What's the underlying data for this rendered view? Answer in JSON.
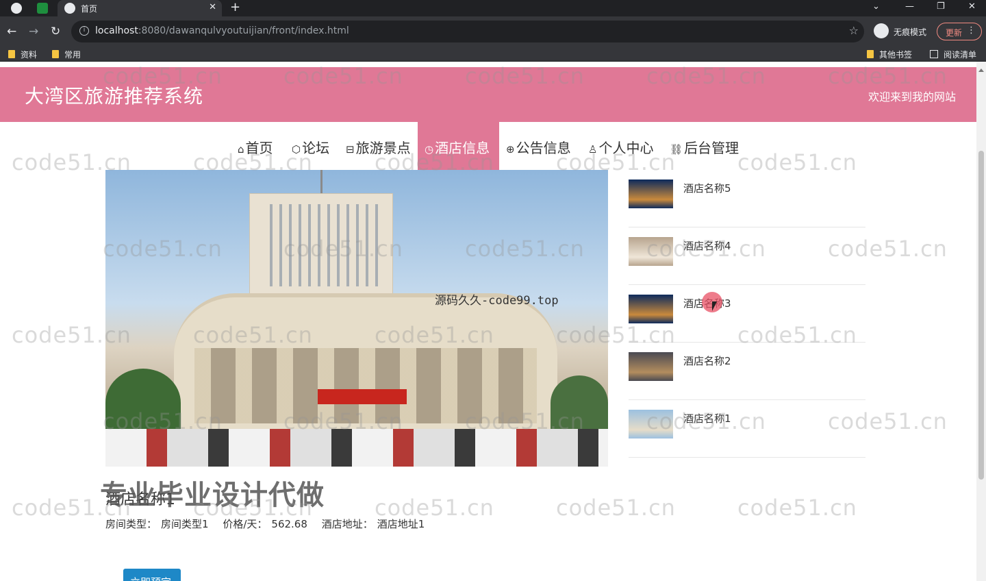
{
  "browser": {
    "tab_title": "首页",
    "url_host": "localhost",
    "url_path": ":8080/dawanqulvyoutuijian/front/index.html",
    "incognito_label": "无痕模式",
    "update_label": "更新",
    "bookmarks": [
      "资料",
      "常用"
    ],
    "bookmarks_right": [
      "其他书签",
      "阅读清单"
    ]
  },
  "site": {
    "title": "大湾区旅游推荐系统",
    "welcome": "欢迎来到我的网站",
    "accent_color": "#e07896"
  },
  "nav": [
    {
      "label": "首页",
      "icon": "home-icon",
      "glyph": "⌂"
    },
    {
      "label": "论坛",
      "icon": "cube-icon",
      "glyph": "⬡"
    },
    {
      "label": "旅游景点",
      "icon": "gift-icon",
      "glyph": "⊟"
    },
    {
      "label": "酒店信息",
      "icon": "clock-icon",
      "glyph": "◷",
      "active": true
    },
    {
      "label": "公告信息",
      "icon": "globe-icon",
      "glyph": "⊕"
    },
    {
      "label": "个人中心",
      "icon": "user-icon",
      "glyph": "♙"
    },
    {
      "label": "后台管理",
      "icon": "link-icon",
      "glyph": "⛓"
    }
  ],
  "hotels": [
    {
      "name": "酒店名称5",
      "thumb_colors": [
        "#0d2a5c",
        "#c98a3c"
      ]
    },
    {
      "name": "酒店名称4",
      "thumb_colors": [
        "#b7a48e",
        "#efe6d8"
      ]
    },
    {
      "name": "酒店名称3",
      "thumb_colors": [
        "#0d2a5c",
        "#c98a3c"
      ]
    },
    {
      "name": "酒店名称2",
      "thumb_colors": [
        "#4a4a52",
        "#b38d5e"
      ]
    },
    {
      "name": "酒店名称1",
      "thumb_colors": [
        "#9cc0e0",
        "#e6ddc9"
      ]
    }
  ],
  "detail": {
    "name": "酒店名称1",
    "room_type_label": "房间类型：",
    "room_type": "房间类型1",
    "price_label": "价格/天：",
    "price": "562.68",
    "address_label": "酒店地址：",
    "address": "酒店地址1",
    "book_label": "立即预定"
  },
  "overlays": {
    "code_text": "源码久久-code99.top",
    "promo_text": "专业毕业设计代做",
    "watermark": "code51.cn"
  }
}
